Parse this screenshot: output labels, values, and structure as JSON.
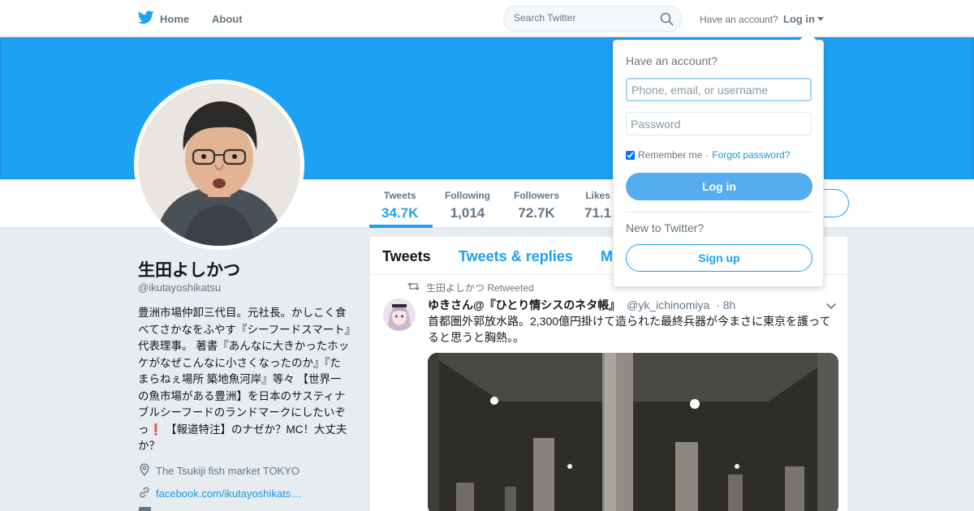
{
  "colors": {
    "brand": "#1da1f2",
    "link": "#1b95e0",
    "login_button": "#55acee",
    "banner": "#1da1f2",
    "text_secondary": "#657786"
  },
  "topnav": {
    "home_label": "Home",
    "about_label": "About",
    "search_placeholder": "Search Twitter",
    "have_account": "Have an account?",
    "login_label": "Log in"
  },
  "profile": {
    "name": "生田よしかつ",
    "handle": "@ikutayoshikatsu",
    "bio": "豊洲市場仲卸三代目。元社長。かしこく食べてさかなをふやす『シーフードスマート』代表理事。 著書『あんなに大きかったホッケがなぜこんなに小さくなったのか』『たまらねぇ場所 築地魚河岸』等々 【世界一の魚市場がある豊洲】を日本のサスティナブルシーフードのランドマークにしたいぞっ❗️ 【報道特注】のナゼか？MC！大丈夫か？",
    "location": "The Tsukiji fish market TOKYO",
    "website": "facebook.com/ikutayoshikats…"
  },
  "stats": [
    {
      "label": "Tweets",
      "value": "34.7K"
    },
    {
      "label": "Following",
      "value": "1,014"
    },
    {
      "label": "Followers",
      "value": "72.7K"
    },
    {
      "label": "Likes",
      "value": "71.1"
    }
  ],
  "timeline": {
    "tabs": [
      "Tweets",
      "Tweets & replies",
      "M"
    ],
    "tweet": {
      "retweeted_by": "生田よしかつ Retweeted",
      "display_name": "ゆきさん@『ひとり情シスのネタ帳』",
      "screen_name": "@yk_ichinomiya",
      "time": "· 8h",
      "text": "首都圏外郭放水路。2,300億円掛けて造られた最終兵器が今まさに東京を護ってると思うと胸熱。。"
    }
  },
  "login_dropdown": {
    "title": "Have an account?",
    "username_placeholder": "Phone, email, or username",
    "password_placeholder": "Password",
    "remember_label": "Remember me",
    "separator": "·",
    "forgot_label": "Forgot password?",
    "login_button": "Log in",
    "new_to_twitter": "New to Twitter?",
    "signup_button": "Sign up"
  }
}
